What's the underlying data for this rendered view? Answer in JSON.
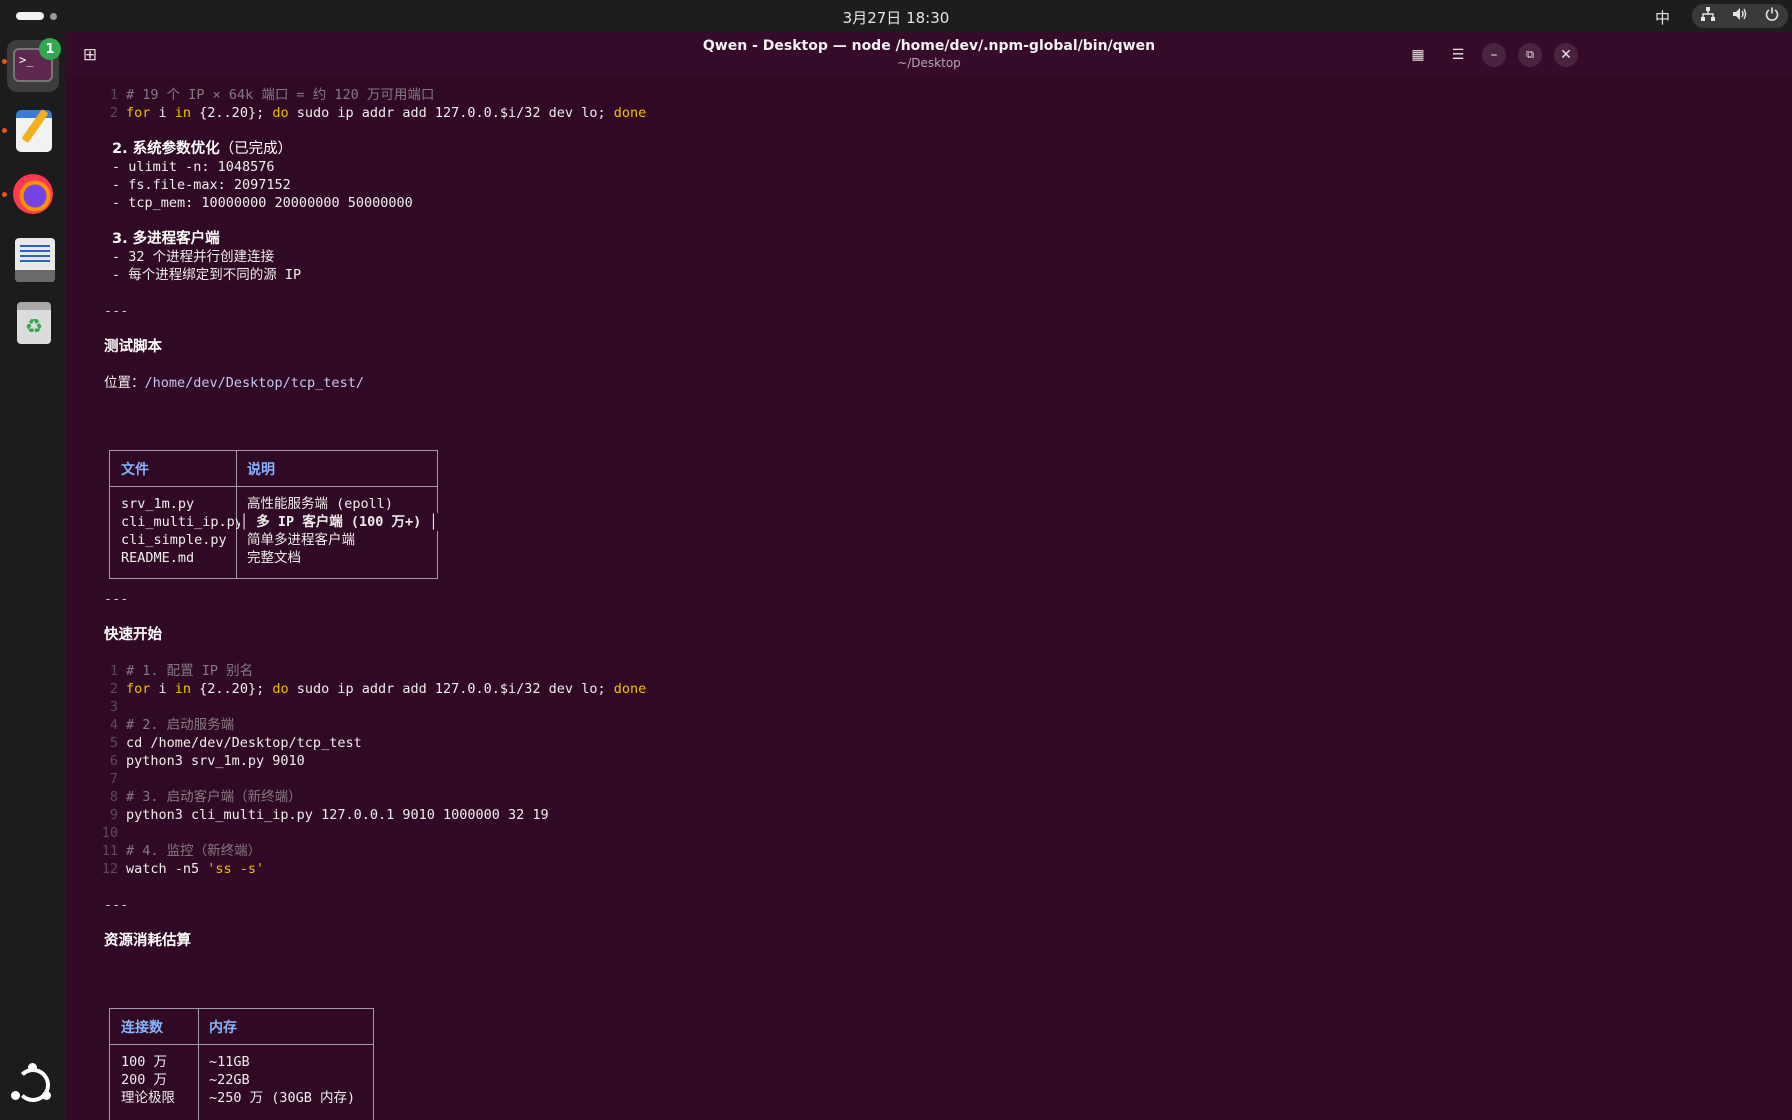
{
  "topbar": {
    "clock": "3月27日 18:30",
    "input_method": "中",
    "tray_icons": [
      "network-icon",
      "volume-icon",
      "power-icon"
    ]
  },
  "dock": {
    "terminal_badge": "1",
    "terminal_glyph": ">_",
    "trash_glyph": "♻",
    "items": [
      "terminal",
      "text-editor",
      "firefox",
      "notes",
      "trash",
      "show-apps"
    ]
  },
  "window": {
    "title": "Qwen - Desktop — node /home/dev/.npm-global/bin/qwen",
    "subtitle": "~/Desktop",
    "icons": {
      "new_tab": "⊞",
      "grid": "▦",
      "menu": "☰",
      "minimize": "–",
      "maximize": "⧉",
      "close": "✕"
    }
  },
  "content": {
    "code1": [
      {
        "n": "1",
        "comment": "# 19 个 IP × 64k 端口 = 约 120 万可用端口"
      },
      {
        "n": "2",
        "kw1": "for",
        "t1": " i ",
        "kw2": "in",
        "t2": " {2..20}; ",
        "kw3": "do",
        "t3": " sudo ip addr add 127.0.0.$i/32 dev lo; ",
        "kw4": "done"
      }
    ],
    "sec2_title": "2. 系统参数优化",
    "sec2_suffix": "（已完成）",
    "sec2_items": [
      "- ulimit -n: 1048576",
      "- fs.file-max: 2097152",
      "- tcp_mem: 10000000 20000000 50000000"
    ],
    "sec3_title": "3. 多进程客户端",
    "sec3_items": [
      "- 32 个进程并行创建连接",
      "- 每个进程绑定到不同的源 IP"
    ],
    "separator": "---",
    "scripts_heading": "测试脚本",
    "location_label": "位置：",
    "location_path": "/home/dev/Desktop/tcp_test/",
    "files_table": {
      "headers": [
        "文件",
        "说明"
      ],
      "rows": [
        {
          "file": "srv_1m.py",
          "desc": "高性能服务端 (epoll)"
        },
        {
          "file": "cli_multi_ip.py",
          "desc": "│ 多 IP 客户端 (100 万+) │"
        },
        {
          "file": "cli_simple.py",
          "desc": "简单多进程客户端"
        },
        {
          "file": "README.md",
          "desc": "完整文档"
        }
      ]
    },
    "quickstart_heading": "快速开始",
    "code2": [
      {
        "n": "1",
        "comment": "# 1. 配置 IP 别名"
      },
      {
        "n": "2",
        "kw1": "for",
        "t1": " i ",
        "kw2": "in",
        "t2": " {2..20}; ",
        "kw3": "do",
        "t3": " sudo ip addr add 127.0.0.$i/32 dev lo; ",
        "kw4": "done"
      },
      {
        "n": "3",
        "text": ""
      },
      {
        "n": "4",
        "comment": "# 2. 启动服务端"
      },
      {
        "n": "5",
        "text": "cd /home/dev/Desktop/tcp_test"
      },
      {
        "n": "6",
        "text": "python3 srv_1m.py 9010"
      },
      {
        "n": "7",
        "text": ""
      },
      {
        "n": "8",
        "comment": "# 3. 启动客户端（新终端）"
      },
      {
        "n": "9",
        "text": "python3 cli_multi_ip.py 127.0.0.1 9010 1000000 32 19"
      },
      {
        "n": "10",
        "text": ""
      },
      {
        "n": "11",
        "comment": "# 4. 监控（新终端）"
      },
      {
        "n": "12",
        "text": "watch -n5 ",
        "str": "'ss -s'"
      }
    ],
    "resource_heading": "资源消耗估算",
    "resource_table": {
      "headers": [
        "连接数",
        "内存"
      ],
      "rows": [
        {
          "conn": "100 万",
          "mem": "~11GB"
        },
        {
          "conn": "200 万",
          "mem": "~22GB"
        },
        {
          "conn": "理论极限",
          "mem": "~250 万 (30GB 内存)"
        }
      ]
    }
  }
}
